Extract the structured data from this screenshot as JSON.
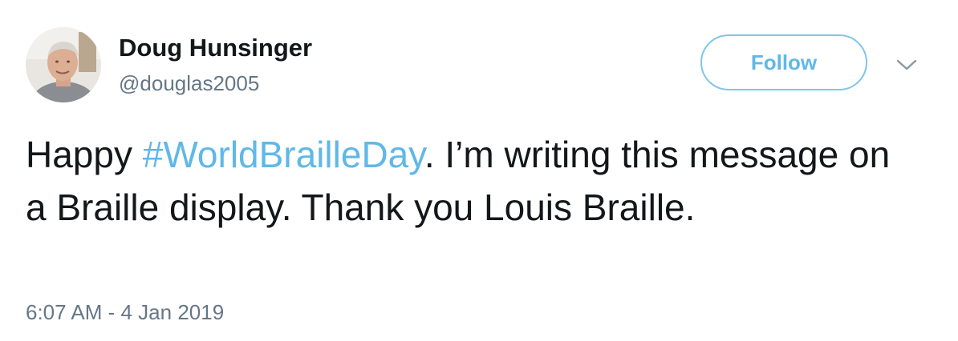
{
  "tweet": {
    "author": {
      "name": "Doug Hunsinger",
      "handle": "@douglas2005",
      "avatar_icon": "user-avatar-photo"
    },
    "follow_label": "Follow",
    "menu_icon": "chevron-down-icon",
    "text": {
      "before": "Happy ",
      "hashtag": "#WorldBrailleDay",
      "after": ". I’m writing this message on a Braille display. Thank you Louis Braille."
    },
    "timestamp": "6:07 AM - 4 Jan 2019"
  },
  "colors": {
    "link": "#5fb8e8",
    "text": "#14171a",
    "secondary": "#657786"
  }
}
